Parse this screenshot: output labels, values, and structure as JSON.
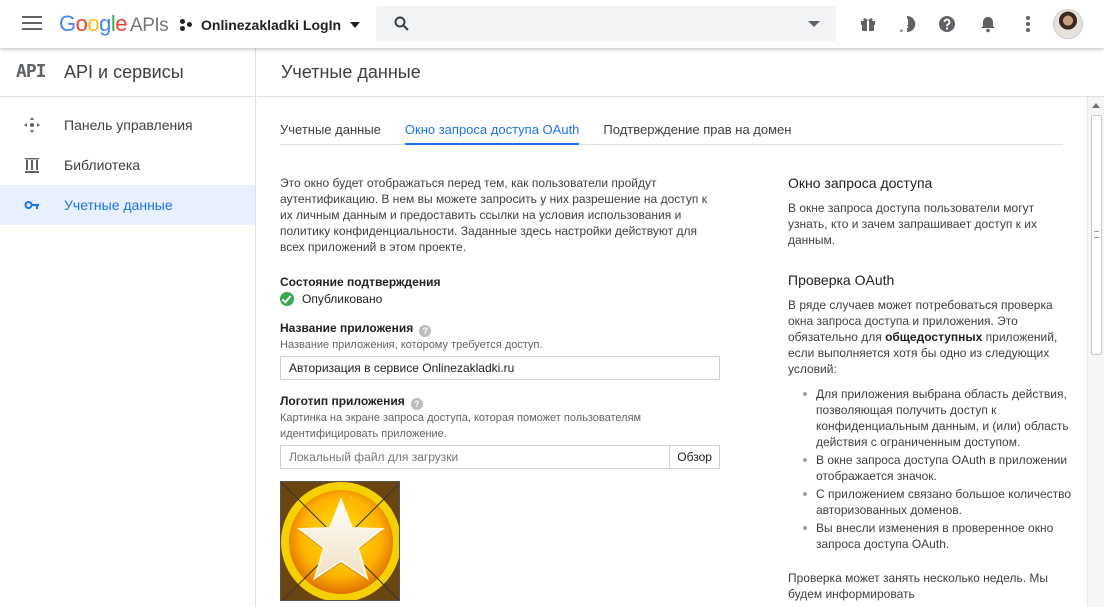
{
  "topbar": {
    "logo_google": "Google",
    "logo_apis": "APIs",
    "project_name": "Onlinezakladki LogIn"
  },
  "sidebar": {
    "api_badge": "API",
    "title": "API и сервисы",
    "items": [
      {
        "label": "Панель управления",
        "icon": "dashboard-icon"
      },
      {
        "label": "Библиотека",
        "icon": "library-icon"
      },
      {
        "label": "Учетные данные",
        "icon": "key-icon",
        "active": true
      }
    ]
  },
  "page": {
    "title": "Учетные данные",
    "tabs": [
      {
        "label": "Учетные данные"
      },
      {
        "label": "Окно запроса доступа OAuth",
        "active": true
      },
      {
        "label": "Подтверждение прав на домен"
      }
    ]
  },
  "form": {
    "intro": "Это окно будет отображаться перед тем, как пользователи пройдут аутентификацию. В нем вы можете запросить у них разрешение на доступ к их личным данным и предоставить ссылки на условия использования и политику конфиденциальности. Заданные здесь настройки действуют для всех приложений в этом проекте.",
    "status_label": "Состояние подтверждения",
    "status_value": "Опубликовано",
    "app_name_label": "Название приложения",
    "app_name_hint": "Название приложения, которому требуется доступ.",
    "app_name_value": "Авторизация в сервисе Onlinezakladki.ru",
    "logo_label": "Логотип приложения",
    "logo_hint": "Картинка на экране запроса доступа, которая поможет пользователям идентифицировать приложение.",
    "file_placeholder": "Локальный файл для загрузки",
    "browse_label": "Обзор"
  },
  "help": {
    "h1": "Окно запроса доступа",
    "p1": "В окне запроса доступа пользователи могут узнать, кто и зачем запрашивает доступ к их данным.",
    "h2": "Проверка OAuth",
    "p2_before": "В ряде случаев может потребоваться проверка окна запроса доступа и приложения. Это обязательно для ",
    "p2_bold": "общедоступных",
    "p2_after": " приложений, если выполняется хотя бы одно из следующих условий:",
    "list": [
      "Для приложения выбрана область действия, позволяющая получить доступ к конфиденциальным данным, и (или) область действия с ограниченным доступом.",
      "В окне запроса доступа OAuth в приложении отображается значок.",
      "С приложением связано большое количество авторизованных доменов.",
      "Вы внесли изменения в проверенное окно запроса доступа OAuth."
    ],
    "p3": "Проверка может занять несколько недель. Мы будем информировать"
  },
  "colors": {
    "accent": "#1a73e8",
    "success": "#34a853"
  }
}
